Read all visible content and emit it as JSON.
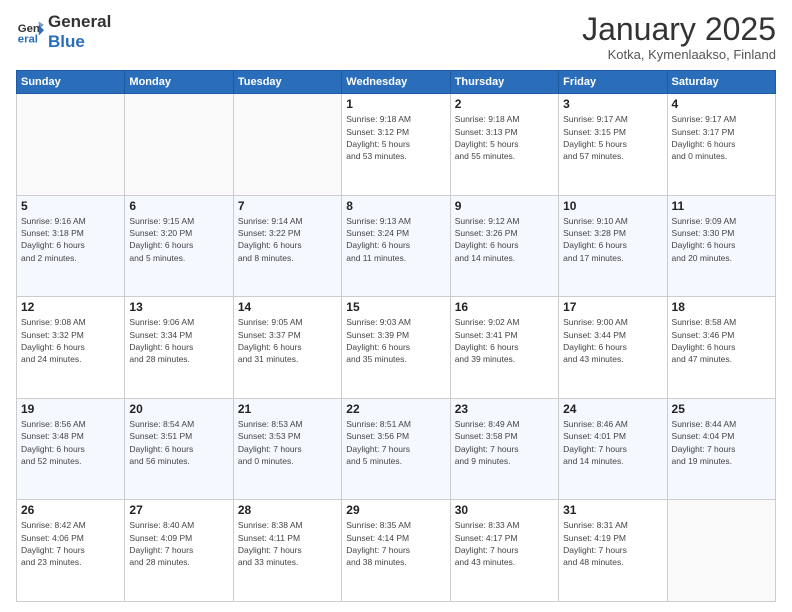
{
  "header": {
    "logo_general": "General",
    "logo_blue": "Blue",
    "month": "January 2025",
    "location": "Kotka, Kymenlaakso, Finland"
  },
  "days_of_week": [
    "Sunday",
    "Monday",
    "Tuesday",
    "Wednesday",
    "Thursday",
    "Friday",
    "Saturday"
  ],
  "weeks": [
    [
      {
        "day": "",
        "info": ""
      },
      {
        "day": "",
        "info": ""
      },
      {
        "day": "",
        "info": ""
      },
      {
        "day": "1",
        "info": "Sunrise: 9:18 AM\nSunset: 3:12 PM\nDaylight: 5 hours\nand 53 minutes."
      },
      {
        "day": "2",
        "info": "Sunrise: 9:18 AM\nSunset: 3:13 PM\nDaylight: 5 hours\nand 55 minutes."
      },
      {
        "day": "3",
        "info": "Sunrise: 9:17 AM\nSunset: 3:15 PM\nDaylight: 5 hours\nand 57 minutes."
      },
      {
        "day": "4",
        "info": "Sunrise: 9:17 AM\nSunset: 3:17 PM\nDaylight: 6 hours\nand 0 minutes."
      }
    ],
    [
      {
        "day": "5",
        "info": "Sunrise: 9:16 AM\nSunset: 3:18 PM\nDaylight: 6 hours\nand 2 minutes."
      },
      {
        "day": "6",
        "info": "Sunrise: 9:15 AM\nSunset: 3:20 PM\nDaylight: 6 hours\nand 5 minutes."
      },
      {
        "day": "7",
        "info": "Sunrise: 9:14 AM\nSunset: 3:22 PM\nDaylight: 6 hours\nand 8 minutes."
      },
      {
        "day": "8",
        "info": "Sunrise: 9:13 AM\nSunset: 3:24 PM\nDaylight: 6 hours\nand 11 minutes."
      },
      {
        "day": "9",
        "info": "Sunrise: 9:12 AM\nSunset: 3:26 PM\nDaylight: 6 hours\nand 14 minutes."
      },
      {
        "day": "10",
        "info": "Sunrise: 9:10 AM\nSunset: 3:28 PM\nDaylight: 6 hours\nand 17 minutes."
      },
      {
        "day": "11",
        "info": "Sunrise: 9:09 AM\nSunset: 3:30 PM\nDaylight: 6 hours\nand 20 minutes."
      }
    ],
    [
      {
        "day": "12",
        "info": "Sunrise: 9:08 AM\nSunset: 3:32 PM\nDaylight: 6 hours\nand 24 minutes."
      },
      {
        "day": "13",
        "info": "Sunrise: 9:06 AM\nSunset: 3:34 PM\nDaylight: 6 hours\nand 28 minutes."
      },
      {
        "day": "14",
        "info": "Sunrise: 9:05 AM\nSunset: 3:37 PM\nDaylight: 6 hours\nand 31 minutes."
      },
      {
        "day": "15",
        "info": "Sunrise: 9:03 AM\nSunset: 3:39 PM\nDaylight: 6 hours\nand 35 minutes."
      },
      {
        "day": "16",
        "info": "Sunrise: 9:02 AM\nSunset: 3:41 PM\nDaylight: 6 hours\nand 39 minutes."
      },
      {
        "day": "17",
        "info": "Sunrise: 9:00 AM\nSunset: 3:44 PM\nDaylight: 6 hours\nand 43 minutes."
      },
      {
        "day": "18",
        "info": "Sunrise: 8:58 AM\nSunset: 3:46 PM\nDaylight: 6 hours\nand 47 minutes."
      }
    ],
    [
      {
        "day": "19",
        "info": "Sunrise: 8:56 AM\nSunset: 3:48 PM\nDaylight: 6 hours\nand 52 minutes."
      },
      {
        "day": "20",
        "info": "Sunrise: 8:54 AM\nSunset: 3:51 PM\nDaylight: 6 hours\nand 56 minutes."
      },
      {
        "day": "21",
        "info": "Sunrise: 8:53 AM\nSunset: 3:53 PM\nDaylight: 7 hours\nand 0 minutes."
      },
      {
        "day": "22",
        "info": "Sunrise: 8:51 AM\nSunset: 3:56 PM\nDaylight: 7 hours\nand 5 minutes."
      },
      {
        "day": "23",
        "info": "Sunrise: 8:49 AM\nSunset: 3:58 PM\nDaylight: 7 hours\nand 9 minutes."
      },
      {
        "day": "24",
        "info": "Sunrise: 8:46 AM\nSunset: 4:01 PM\nDaylight: 7 hours\nand 14 minutes."
      },
      {
        "day": "25",
        "info": "Sunrise: 8:44 AM\nSunset: 4:04 PM\nDaylight: 7 hours\nand 19 minutes."
      }
    ],
    [
      {
        "day": "26",
        "info": "Sunrise: 8:42 AM\nSunset: 4:06 PM\nDaylight: 7 hours\nand 23 minutes."
      },
      {
        "day": "27",
        "info": "Sunrise: 8:40 AM\nSunset: 4:09 PM\nDaylight: 7 hours\nand 28 minutes."
      },
      {
        "day": "28",
        "info": "Sunrise: 8:38 AM\nSunset: 4:11 PM\nDaylight: 7 hours\nand 33 minutes."
      },
      {
        "day": "29",
        "info": "Sunrise: 8:35 AM\nSunset: 4:14 PM\nDaylight: 7 hours\nand 38 minutes."
      },
      {
        "day": "30",
        "info": "Sunrise: 8:33 AM\nSunset: 4:17 PM\nDaylight: 7 hours\nand 43 minutes."
      },
      {
        "day": "31",
        "info": "Sunrise: 8:31 AM\nSunset: 4:19 PM\nDaylight: 7 hours\nand 48 minutes."
      },
      {
        "day": "",
        "info": ""
      }
    ]
  ]
}
